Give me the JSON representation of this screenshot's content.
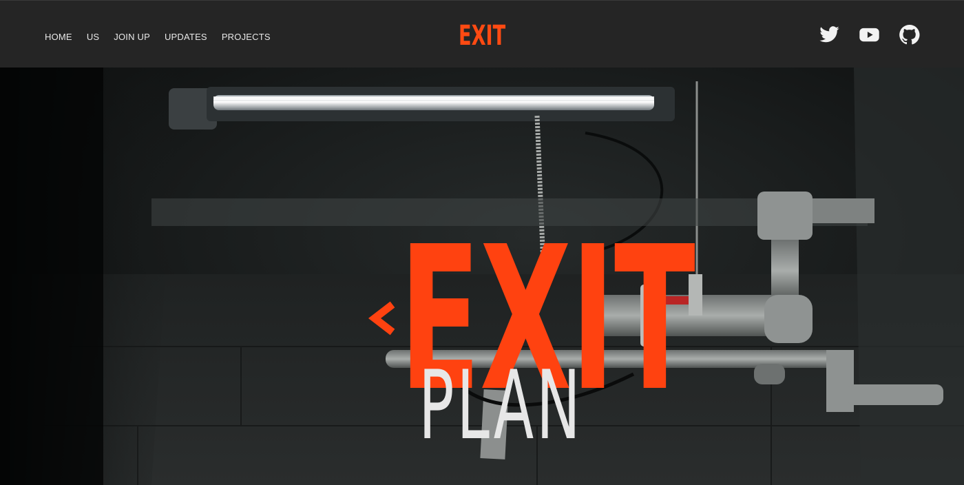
{
  "nav": {
    "items": [
      {
        "label": "HOME"
      },
      {
        "label": "US"
      },
      {
        "label": "JOIN UP"
      },
      {
        "label": "UPDATES"
      },
      {
        "label": "PROJECTS"
      }
    ]
  },
  "brand": {
    "text": "EXIT",
    "chevron_icon": "chevron-left-icon",
    "color": "#ff4a12"
  },
  "social": [
    {
      "icon": "twitter-icon"
    },
    {
      "icon": "youtube-icon"
    },
    {
      "icon": "github-icon"
    }
  ],
  "hero": {
    "logo_top": "EXIT",
    "logo_bottom": "PLAN",
    "accent_color": "#ff4210",
    "text_color": "#e7e7e7"
  },
  "colors": {
    "header_bg": "#252525",
    "nav_text": "#e9e9e9"
  }
}
